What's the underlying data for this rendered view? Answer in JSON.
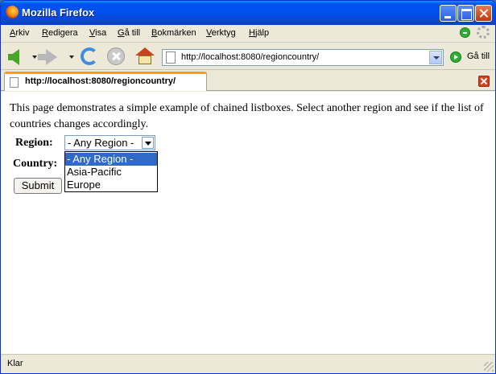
{
  "window": {
    "title": "Mozilla Firefox"
  },
  "menubar": {
    "items": [
      {
        "label": "Arkiv"
      },
      {
        "label": "Redigera"
      },
      {
        "label": "Visa"
      },
      {
        "label": "Gå till"
      },
      {
        "label": "Bokmärken"
      },
      {
        "label": "Verktyg"
      },
      {
        "label": "Hjälp"
      }
    ]
  },
  "navbar": {
    "url": "http://localhost:8080/regioncountry/",
    "go_label": "Gå till",
    "icons": [
      "back-icon",
      "forward-icon",
      "reload-icon",
      "stop-icon",
      "home-icon"
    ]
  },
  "tabs": [
    {
      "label": "http://localhost:8080/regioncountry/",
      "active": true
    }
  ],
  "page": {
    "intro": "This page demonstrates a simple example of chained listboxes. Select another region and see if the list of countries changes accordingly.",
    "region_label": "Region:",
    "country_label": "Country:",
    "region_select": {
      "selected": "- Any Region -",
      "options": [
        "- Any Region -",
        "Asia-Pacific",
        "Europe"
      ],
      "highlighted_index": 0,
      "open": true
    },
    "submit_label": "Submit"
  },
  "statusbar": {
    "text": "Klar"
  },
  "colors": {
    "titlebar": "#0053ee",
    "selection": "#316ac5",
    "tab_accent": "#f5a00d"
  }
}
